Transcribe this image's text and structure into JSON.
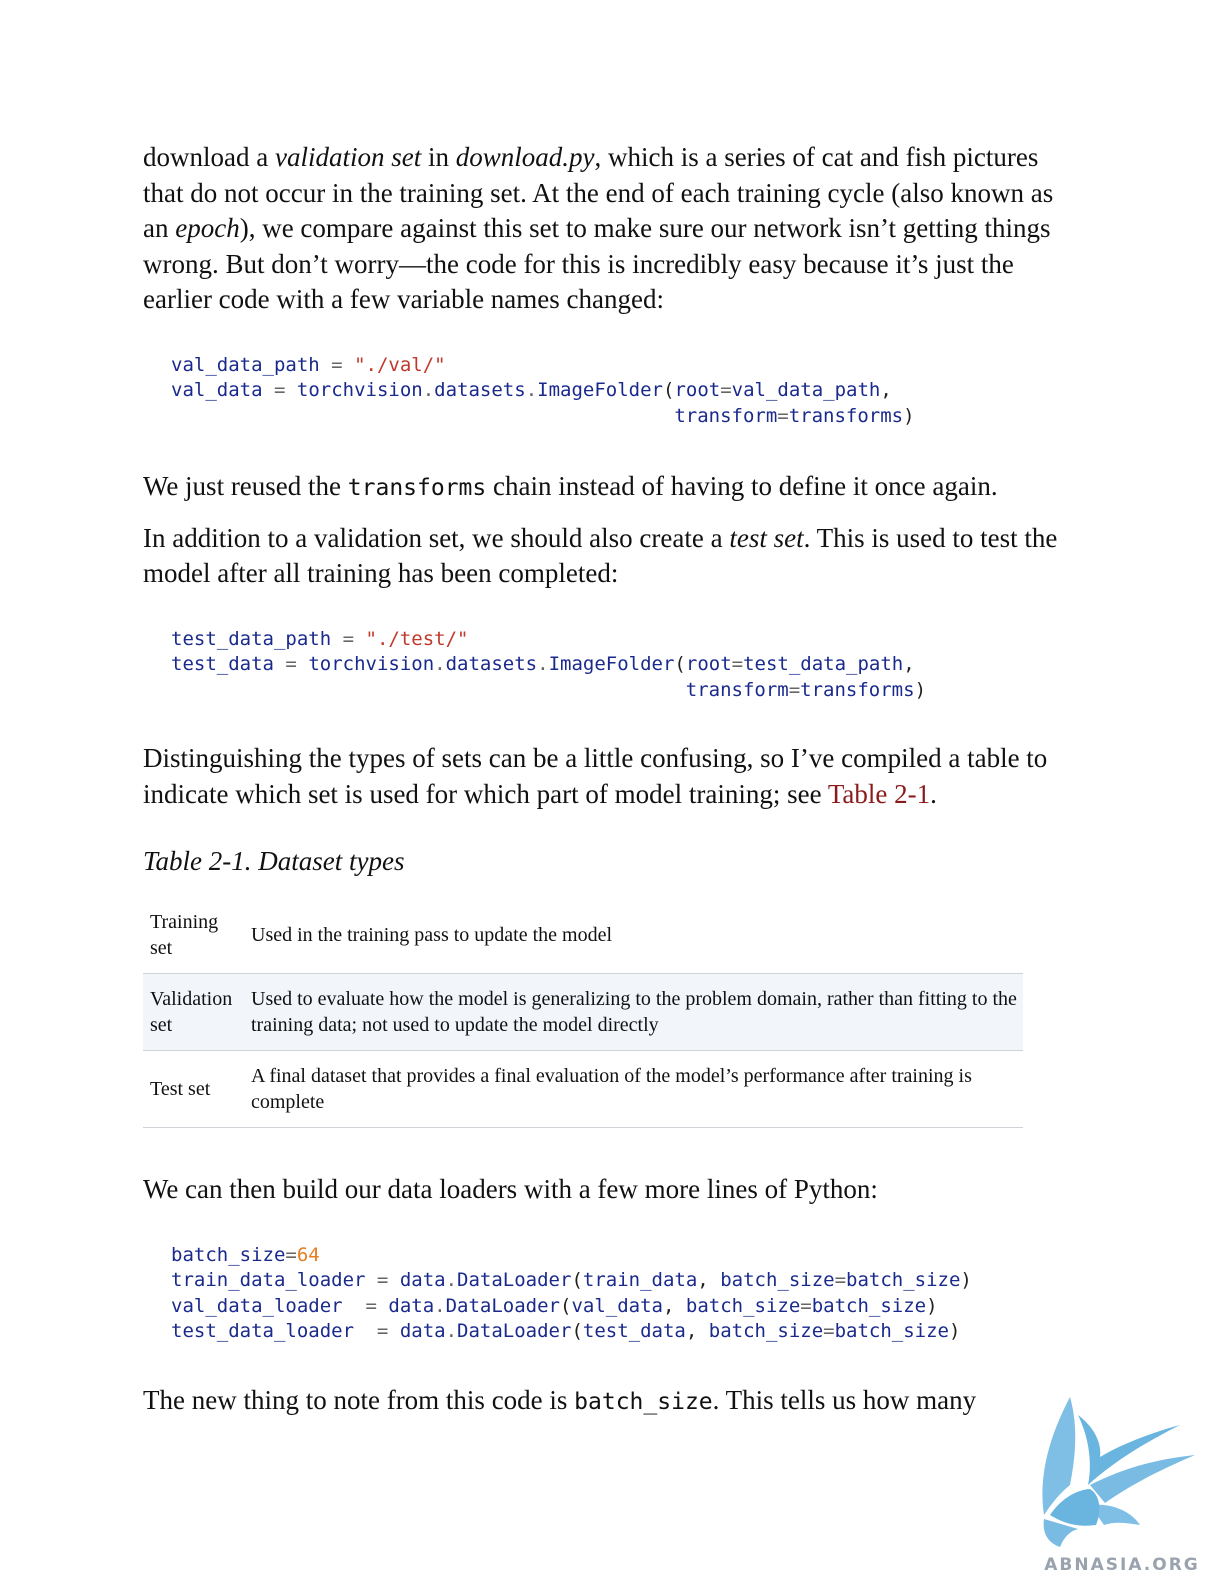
{
  "para1": {
    "t1": "download a ",
    "em1": "validation set",
    "t2": " in ",
    "em2": "download.py",
    "t3": ", which is a series of cat and fish pictures that do not occur in the training set. At the end of each training cycle (also known as an ",
    "em3": "epoch",
    "t4": "), we compare against this set to make sure our network isn’t getting things wrong. But don’t worry—the code for this is incredibly easy because it’s just the earlier code with a few variable names changed:"
  },
  "code1": {
    "l1_var": "val_data_path",
    "l1_str": "\"./val/\"",
    "l2_var": "val_data",
    "l2_mod": "torchvision",
    "l2_mod2": "datasets",
    "l2_cls": "ImageFolder",
    "l2_kw": "root",
    "l2_arg": "val_data_path",
    "l3_kw": "transform",
    "l3_arg": "transforms"
  },
  "para2": {
    "t1": "We just reused the ",
    "code": "transforms",
    "t2": " chain instead of having to define it once again."
  },
  "para3": {
    "t1": "In addition to a validation set, we should also create a ",
    "em1": "test set",
    "t2": ". This is used to test the model after all training has been completed:"
  },
  "code2": {
    "l1_var": "test_data_path",
    "l1_str": "\"./test/\"",
    "l2_var": "test_data",
    "l2_mod": "torchvision",
    "l2_mod2": "datasets",
    "l2_cls": "ImageFolder",
    "l2_kw": "root",
    "l2_arg": "test_data_path",
    "l3_kw": "transform",
    "l3_arg": "transforms"
  },
  "para4": {
    "t1": "Distinguishing the types of sets can be a little confusing, so I’ve compiled a table to indicate which set is used for which part of model training; see ",
    "link": "Table 2-1",
    "t2": "."
  },
  "table_caption": "Table 2-1. Dataset types",
  "table": {
    "rows": [
      {
        "term": "Training set",
        "desc": "Used in the training pass to update the model"
      },
      {
        "term": "Validation set",
        "desc": "Used to evaluate how the model is generalizing to the problem domain, rather than fitting to the training data; not used to update the model directly"
      },
      {
        "term": "Test set",
        "desc": "A final dataset that provides a final evaluation of the model’s performance after training is complete"
      }
    ]
  },
  "para5": "We can then build our data loaders with a few more lines of Python:",
  "code3": {
    "l1_var": "batch_size",
    "l1_num": "64",
    "l2_var": "train_data_loader",
    "l2_mod": "data",
    "l2_cls": "DataLoader",
    "l2_a1": "train_data",
    "l2_kw": "batch_size",
    "l2_a2": "batch_size",
    "l3_var": "val_data_loader",
    "l3_mod": "data",
    "l3_cls": "DataLoader",
    "l3_a1": "val_data",
    "l3_kw": "batch_size",
    "l3_a2": "batch_size",
    "l4_var": "test_data_loader",
    "l4_mod": "data",
    "l4_cls": "DataLoader",
    "l4_a1": "test_data",
    "l4_kw": "batch_size",
    "l4_a2": "batch_size"
  },
  "para6": {
    "t1": "The new thing to note from this code is ",
    "code": "batch_size",
    "t2": ". This tells us how many"
  },
  "watermark": {
    "text": "ABNASIA.ORG",
    "color": "#6ab4e0"
  }
}
